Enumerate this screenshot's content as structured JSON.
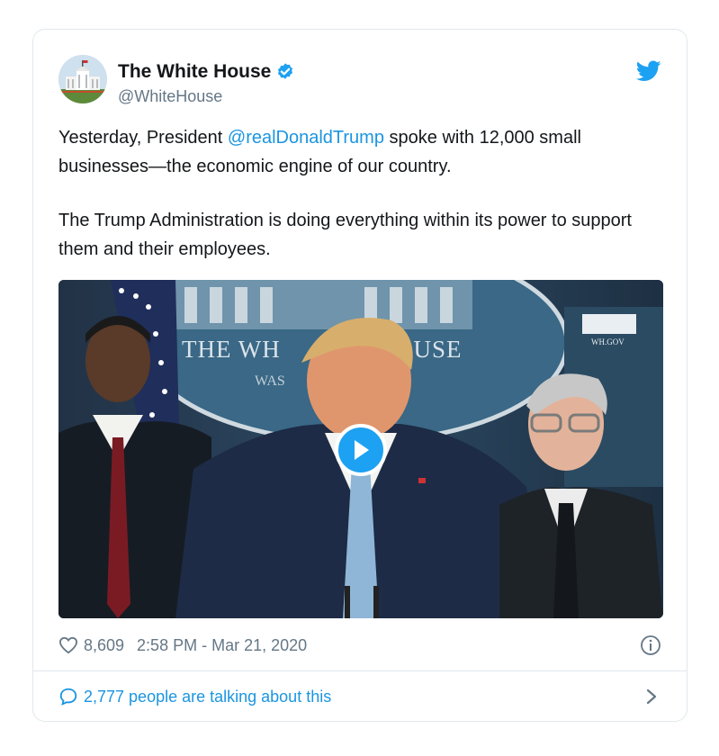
{
  "author": {
    "display_name": "The White House",
    "handle": "@WhiteHouse"
  },
  "tweet": {
    "p1_before": "Yesterday, President ",
    "p1_mention": "@realDonaldTrump",
    "p1_after": " spoke with 12,000 small businesses—the economic engine of our country.",
    "p2": "The Trump Administration is doing everything within its power to support them and their employees."
  },
  "media": {
    "backdrop_text": "THE WH",
    "backdrop_text_2": "OUSE",
    "backdrop_text_3": "WAS",
    "sign_text": "WH.GOV"
  },
  "meta": {
    "likes": "8,609",
    "timestamp": "2:58 PM - Mar 21, 2020"
  },
  "footer": {
    "talking": "2,777 people are talking about this"
  },
  "colors": {
    "accent": "#1da1f2",
    "link": "#1b95e0",
    "muted": "#657786"
  }
}
